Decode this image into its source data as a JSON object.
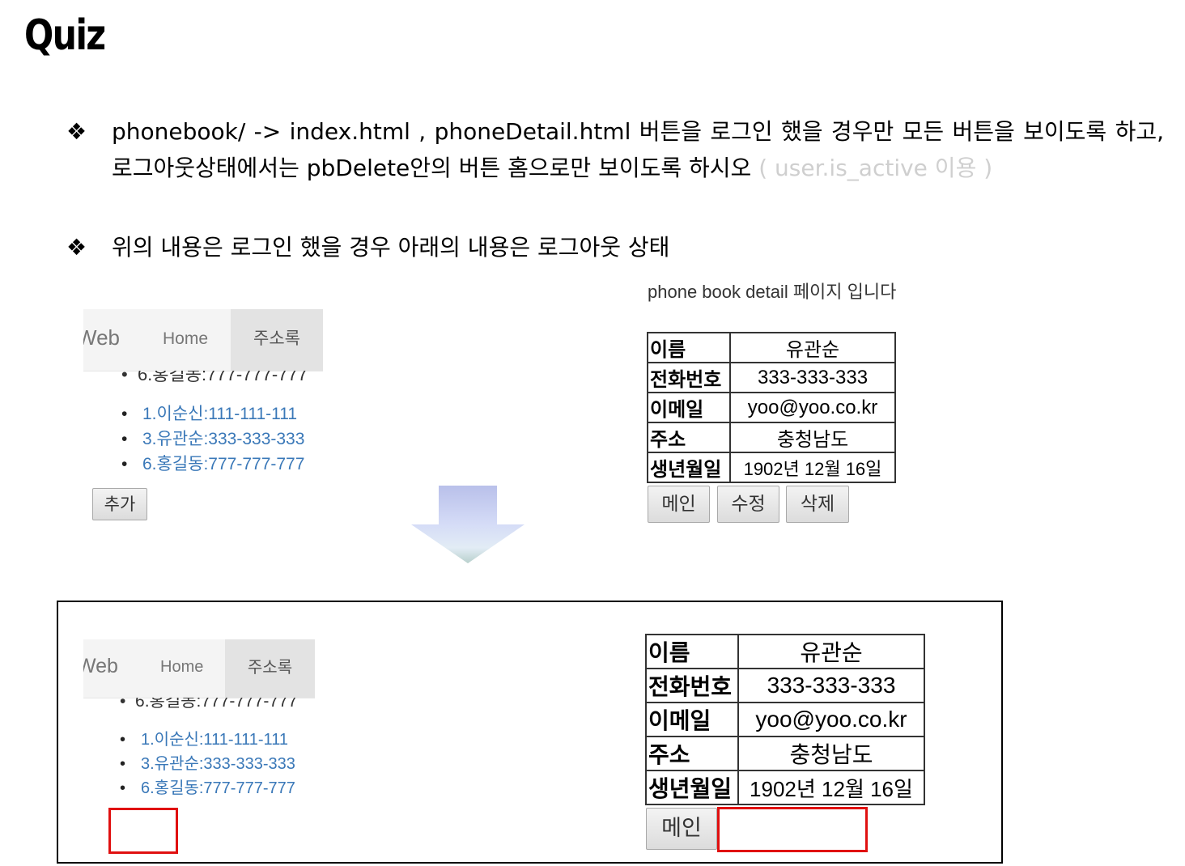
{
  "slide": {
    "title": "Quiz",
    "bullet_mark": "❖",
    "bullet1": {
      "text": "phonebook/ -> index.html , phoneDetail.html 버튼을 로그인 했을 경우만  모든 버튼을 보이도록 하고, 로그아웃상태에서는 pbDelete안의 버튼 홈으로만 보이도록 하시오",
      "hint": "( user.is_active 이용 )"
    },
    "bullet2": "위의 내용은 로그인 했을 경우 아래의 내용은 로그아웃 상태"
  },
  "top": {
    "nav": {
      "brand": "Web",
      "home": "Home",
      "addr": "주소록"
    },
    "cut_item": "6.홍길동:777-777-777",
    "list": [
      "1.이순신:111-111-111",
      "3.유관순:333-333-333",
      "6.홍길동:777-777-777"
    ],
    "add_button": "추가",
    "detail_title": "phone book detail 페이지 입니다",
    "table": [
      {
        "label": "이름",
        "value": "유관순"
      },
      {
        "label": "전화번호",
        "value": "333-333-333"
      },
      {
        "label": "이메일",
        "value": "yoo@yoo.co.kr"
      },
      {
        "label": "주소",
        "value": "충청남도"
      },
      {
        "label": "생년월일",
        "value": "1902년 12월 16일"
      }
    ],
    "buttons": {
      "main": "메인",
      "edit": "수정",
      "delete": "삭제"
    }
  },
  "bottom": {
    "nav": {
      "brand": "Web",
      "home": "Home",
      "addr": "주소록"
    },
    "cut_item": "6.홍길동:777-777-777",
    "list": [
      "1.이순신:111-111-111",
      "3.유관순:333-333-333",
      "6.홍길동:777-777-777"
    ],
    "table": [
      {
        "label": "이름",
        "value": "유관순"
      },
      {
        "label": "전화번호",
        "value": "333-333-333"
      },
      {
        "label": "이메일",
        "value": "yoo@yoo.co.kr"
      },
      {
        "label": "주소",
        "value": "충청남도"
      },
      {
        "label": "생년월일",
        "value": "1902년 12월 16일"
      }
    ],
    "buttons": {
      "main": "메인"
    }
  },
  "colors": {
    "link": "#3a78b8",
    "highlight": "#e01010",
    "hint": "#cfcfcf"
  }
}
